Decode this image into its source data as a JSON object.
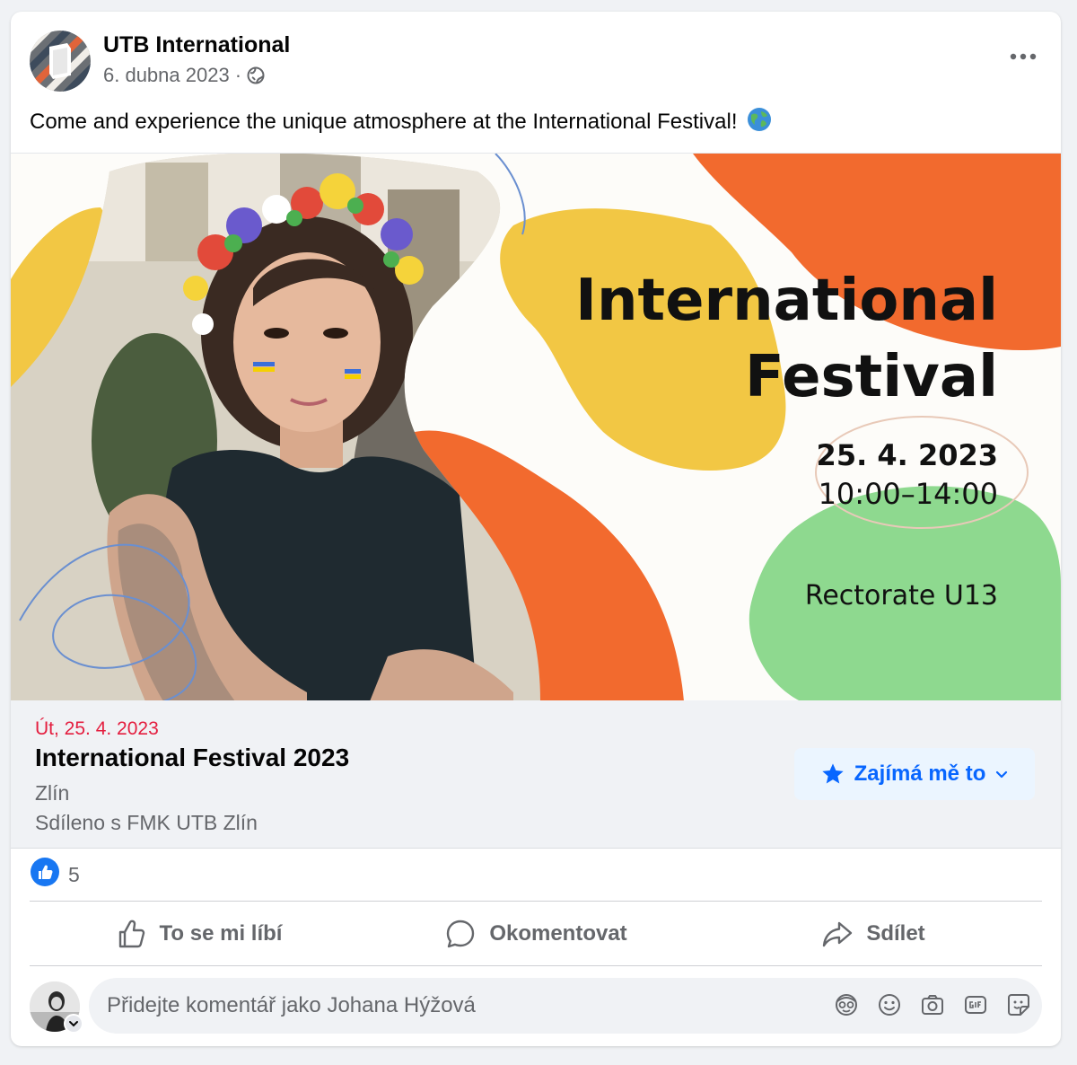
{
  "post": {
    "author": "UTB International",
    "date": "6. dubna 2023",
    "separator": "·",
    "audience_icon": "globe-icon",
    "text": "Come and experience the unique atmosphere at the International Festival!",
    "text_emoji": "globe-emoji"
  },
  "image": {
    "title_line1": "International",
    "title_line2": "Festival",
    "date": "25. 4. 2023",
    "time": "10:00–14:00",
    "place": "Rectorate U13",
    "colors": {
      "yellow": "#f2c744",
      "orange": "#f26a2e",
      "green": "#8ed98f"
    }
  },
  "event": {
    "date": "Út, 25. 4. 2023",
    "title": "International Festival 2023",
    "location": "Zlín",
    "shared": "Sdíleno s FMK UTB Zlín",
    "interest_label": "Zajímá mě to",
    "accent": "#0866ff"
  },
  "reactions": {
    "count": "5",
    "icon": "like-icon"
  },
  "actions": [
    {
      "label": "To se mi líbí",
      "icon": "thumbs-up-icon"
    },
    {
      "label": "Okomentovat",
      "icon": "comment-icon"
    },
    {
      "label": "Sdílet",
      "icon": "share-icon"
    }
  ],
  "comment": {
    "placeholder": "Přidejte komentář jako Johana Hýžová",
    "tools": [
      "avatar-sticker-icon",
      "emoji-icon",
      "camera-icon",
      "gif-icon",
      "sticker-icon"
    ]
  }
}
